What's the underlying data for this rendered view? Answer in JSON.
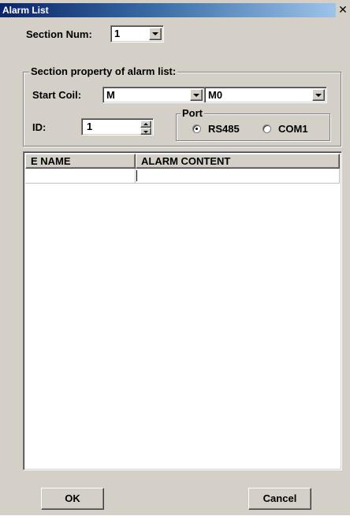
{
  "window": {
    "title": "Alarm List",
    "close_glyph": "✕"
  },
  "section_num": {
    "label": "Section Num:",
    "value": "1"
  },
  "section_property": {
    "title": "Section property of alarm list:",
    "start_coil_label": "Start Coil:",
    "start_coil_type": "M",
    "start_coil_address": "M0",
    "id_label": "ID:",
    "id_value": "1"
  },
  "port": {
    "title": "Port",
    "options": [
      {
        "label": "RS485",
        "selected": true
      },
      {
        "label": "COM1",
        "selected": false
      }
    ]
  },
  "alarm_table": {
    "columns": [
      "E NAME",
      "ALARM CONTENT"
    ],
    "rows": [
      [
        "",
        ""
      ]
    ]
  },
  "buttons": {
    "ok": "OK",
    "cancel": "Cancel"
  },
  "icons": {
    "close": "close-icon",
    "dropdown": "chevron-down-icon",
    "spin_up": "spin-up-icon",
    "spin_down": "spin-down-icon"
  }
}
